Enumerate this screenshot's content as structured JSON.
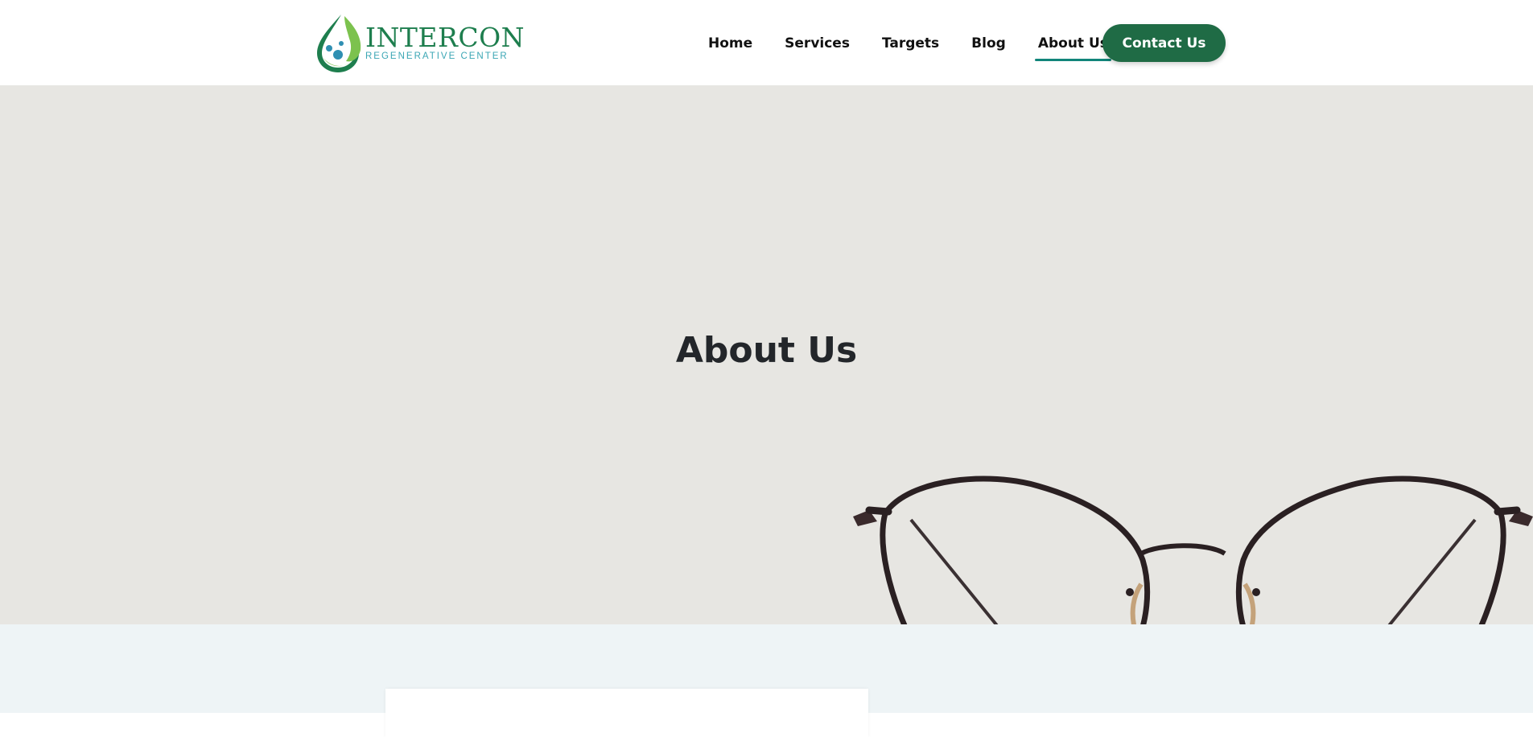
{
  "logo": {
    "name": "INTERCON",
    "tagline": "REGENERATIVE CENTER",
    "colors": {
      "dark_green": "#1e7e4e",
      "light_green": "#7cc24e",
      "teal": "#3aa6b4"
    }
  },
  "nav": {
    "items": [
      {
        "label": "Home",
        "active": false
      },
      {
        "label": "Services",
        "active": false
      },
      {
        "label": "Targets",
        "active": false
      },
      {
        "label": "Blog",
        "active": false
      },
      {
        "label": "About Us",
        "active": true
      }
    ],
    "contact_label": "Contact Us"
  },
  "hero": {
    "title": "About Us",
    "image": "eyeglasses"
  },
  "colors": {
    "accent": "#1f6b45",
    "active_underline": "#11857a",
    "hero_bg": "#e7e6e2",
    "section_bg": "#eef4f6"
  }
}
